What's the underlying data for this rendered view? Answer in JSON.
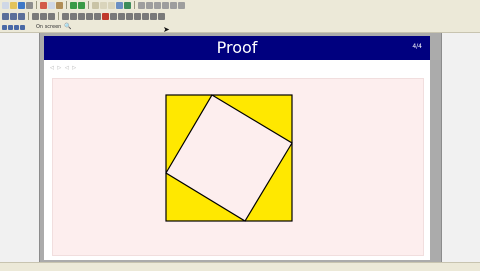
{
  "toolbar": {
    "zoom_label": "On screen",
    "icons": [
      "new-icon",
      "open-icon",
      "save-icon",
      "print-icon",
      "cut-icon",
      "copy-icon",
      "paste-icon",
      "undo-icon",
      "redo-icon",
      "zoom-icon"
    ]
  },
  "slide": {
    "title": "Proof",
    "page_number": "4/4",
    "nav_symbols": "◁ ▷ ◁ ▷",
    "header_color": "#00007f",
    "block_color": "#fdeeee",
    "figure_fill_color": "#ffe800",
    "inner_square_color": "#fdeeee"
  },
  "statusbar": {
    "text": ""
  }
}
